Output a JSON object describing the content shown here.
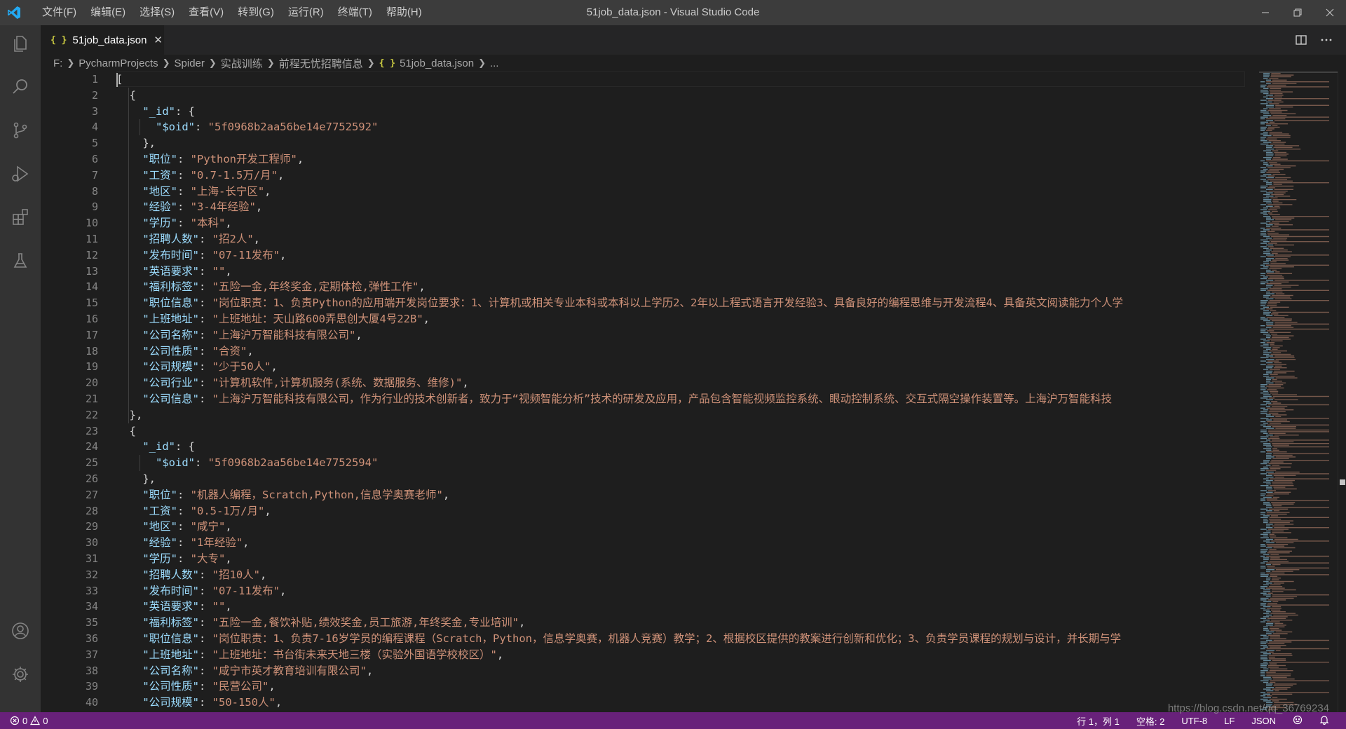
{
  "window": {
    "title": "51job_data.json - Visual Studio Code",
    "menu": [
      "文件(F)",
      "编辑(E)",
      "选择(S)",
      "查看(V)",
      "转到(G)",
      "运行(R)",
      "终端(T)",
      "帮助(H)"
    ]
  },
  "activity_bar": [
    "explorer-icon",
    "search-icon",
    "source-control-icon",
    "run-debug-icon",
    "extensions-icon",
    "testing-icon",
    "account-icon",
    "settings-gear-icon"
  ],
  "tab": {
    "icon": "{ }",
    "label": "51job_data.json",
    "close": "✕"
  },
  "breadcrumb": [
    "F:",
    "PycharmProjects",
    "Spider",
    "实战训练",
    "前程无忧招聘信息",
    "51job_data.json",
    "..."
  ],
  "editor": {
    "line_numbers": [
      "1",
      "2",
      "3",
      "4",
      "5",
      "6",
      "7",
      "8",
      "9",
      "10",
      "11",
      "12",
      "13",
      "14",
      "15",
      "16",
      "17",
      "18",
      "19",
      "20",
      "21",
      "22",
      "23",
      "24",
      "25",
      "26",
      "27",
      "28",
      "29",
      "30",
      "31",
      "32",
      "33",
      "34",
      "35",
      "36",
      "37",
      "38",
      "39",
      "40"
    ],
    "lines": [
      [
        [
          "p",
          "["
        ]
      ],
      [
        [
          "p",
          "  {"
        ]
      ],
      [
        [
          "k",
          "    \"_id\""
        ],
        [
          "p",
          ": {"
        ]
      ],
      [
        [
          "k",
          "      \"$oid\""
        ],
        [
          "p",
          ": "
        ],
        [
          "s",
          "\"5f0968b2aa56be14e7752592\""
        ]
      ],
      [
        [
          "p",
          "    },"
        ]
      ],
      [
        [
          "k",
          "    \"职位\""
        ],
        [
          "p",
          ": "
        ],
        [
          "s",
          "\"Python开发工程师\""
        ],
        [
          "p",
          ","
        ]
      ],
      [
        [
          "k",
          "    \"工资\""
        ],
        [
          "p",
          ": "
        ],
        [
          "s",
          "\"0.7-1.5万/月\""
        ],
        [
          "p",
          ","
        ]
      ],
      [
        [
          "k",
          "    \"地区\""
        ],
        [
          "p",
          ": "
        ],
        [
          "s",
          "\"上海-长宁区\""
        ],
        [
          "p",
          ","
        ]
      ],
      [
        [
          "k",
          "    \"经验\""
        ],
        [
          "p",
          ": "
        ],
        [
          "s",
          "\"3-4年经验\""
        ],
        [
          "p",
          ","
        ]
      ],
      [
        [
          "k",
          "    \"学历\""
        ],
        [
          "p",
          ": "
        ],
        [
          "s",
          "\"本科\""
        ],
        [
          "p",
          ","
        ]
      ],
      [
        [
          "k",
          "    \"招聘人数\""
        ],
        [
          "p",
          ": "
        ],
        [
          "s",
          "\"招2人\""
        ],
        [
          "p",
          ","
        ]
      ],
      [
        [
          "k",
          "    \"发布时间\""
        ],
        [
          "p",
          ": "
        ],
        [
          "s",
          "\"07-11发布\""
        ],
        [
          "p",
          ","
        ]
      ],
      [
        [
          "k",
          "    \"英语要求\""
        ],
        [
          "p",
          ": "
        ],
        [
          "s",
          "\"\""
        ],
        [
          "p",
          ","
        ]
      ],
      [
        [
          "k",
          "    \"福利标签\""
        ],
        [
          "p",
          ": "
        ],
        [
          "s",
          "\"五险一金,年终奖金,定期体检,弹性工作\""
        ],
        [
          "p",
          ","
        ]
      ],
      [
        [
          "k",
          "    \"职位信息\""
        ],
        [
          "p",
          ": "
        ],
        [
          "s",
          "\"岗位职责：1、负责Python的应用端开发岗位要求：1、计算机或相关专业本科或本科以上学历2、2年以上程式语言开发经验3、具备良好的编程思维与开发流程4、具备英文阅读能力个人学"
        ]
      ],
      [
        [
          "k",
          "    \"上班地址\""
        ],
        [
          "p",
          ": "
        ],
        [
          "s",
          "\"上班地址：天山路600弄思创大厦4号22B\""
        ],
        [
          "p",
          ","
        ]
      ],
      [
        [
          "k",
          "    \"公司名称\""
        ],
        [
          "p",
          ": "
        ],
        [
          "s",
          "\"上海沪万智能科技有限公司\""
        ],
        [
          "p",
          ","
        ]
      ],
      [
        [
          "k",
          "    \"公司性质\""
        ],
        [
          "p",
          ": "
        ],
        [
          "s",
          "\"合资\""
        ],
        [
          "p",
          ","
        ]
      ],
      [
        [
          "k",
          "    \"公司规模\""
        ],
        [
          "p",
          ": "
        ],
        [
          "s",
          "\"少于50人\""
        ],
        [
          "p",
          ","
        ]
      ],
      [
        [
          "k",
          "    \"公司行业\""
        ],
        [
          "p",
          ": "
        ],
        [
          "s",
          "\"计算机软件,计算机服务(系统、数据服务、维修)\""
        ],
        [
          "p",
          ","
        ]
      ],
      [
        [
          "k",
          "    \"公司信息\""
        ],
        [
          "p",
          ": "
        ],
        [
          "s",
          "\"上海沪万智能科技有限公司，作为行业的技术创新者，致力于“视频智能分析”技术的研发及应用，产品包含智能视频监控系统、眼动控制系统、交互式隔空操作装置等。上海沪万智能科技"
        ]
      ],
      [
        [
          "p",
          "  },"
        ]
      ],
      [
        [
          "p",
          "  {"
        ]
      ],
      [
        [
          "k",
          "    \"_id\""
        ],
        [
          "p",
          ": {"
        ]
      ],
      [
        [
          "k",
          "      \"$oid\""
        ],
        [
          "p",
          ": "
        ],
        [
          "s",
          "\"5f0968b2aa56be14e7752594\""
        ]
      ],
      [
        [
          "p",
          "    },"
        ]
      ],
      [
        [
          "k",
          "    \"职位\""
        ],
        [
          "p",
          ": "
        ],
        [
          "s",
          "\"机器人编程，Scratch,Python,信息学奥赛老师\""
        ],
        [
          "p",
          ","
        ]
      ],
      [
        [
          "k",
          "    \"工资\""
        ],
        [
          "p",
          ": "
        ],
        [
          "s",
          "\"0.5-1万/月\""
        ],
        [
          "p",
          ","
        ]
      ],
      [
        [
          "k",
          "    \"地区\""
        ],
        [
          "p",
          ": "
        ],
        [
          "s",
          "\"咸宁\""
        ],
        [
          "p",
          ","
        ]
      ],
      [
        [
          "k",
          "    \"经验\""
        ],
        [
          "p",
          ": "
        ],
        [
          "s",
          "\"1年经验\""
        ],
        [
          "p",
          ","
        ]
      ],
      [
        [
          "k",
          "    \"学历\""
        ],
        [
          "p",
          ": "
        ],
        [
          "s",
          "\"大专\""
        ],
        [
          "p",
          ","
        ]
      ],
      [
        [
          "k",
          "    \"招聘人数\""
        ],
        [
          "p",
          ": "
        ],
        [
          "s",
          "\"招10人\""
        ],
        [
          "p",
          ","
        ]
      ],
      [
        [
          "k",
          "    \"发布时间\""
        ],
        [
          "p",
          ": "
        ],
        [
          "s",
          "\"07-11发布\""
        ],
        [
          "p",
          ","
        ]
      ],
      [
        [
          "k",
          "    \"英语要求\""
        ],
        [
          "p",
          ": "
        ],
        [
          "s",
          "\"\""
        ],
        [
          "p",
          ","
        ]
      ],
      [
        [
          "k",
          "    \"福利标签\""
        ],
        [
          "p",
          ": "
        ],
        [
          "s",
          "\"五险一金,餐饮补贴,绩效奖金,员工旅游,年终奖金,专业培训\""
        ],
        [
          "p",
          ","
        ]
      ],
      [
        [
          "k",
          "    \"职位信息\""
        ],
        [
          "p",
          ": "
        ],
        [
          "s",
          "\"岗位职责：1、负责7-16岁学员的编程课程（Scratch，Python，信息学奥赛，机器人竞赛）教学；2、根据校区提供的教案进行创新和优化；3、负责学员课程的规划与设计，并长期与学"
        ]
      ],
      [
        [
          "k",
          "    \"上班地址\""
        ],
        [
          "p",
          ": "
        ],
        [
          "s",
          "\"上班地址：书台街未来天地三楼（实验外国语学校校区）\""
        ],
        [
          "p",
          ","
        ]
      ],
      [
        [
          "k",
          "    \"公司名称\""
        ],
        [
          "p",
          ": "
        ],
        [
          "s",
          "\"咸宁市英才教育培训有限公司\""
        ],
        [
          "p",
          ","
        ]
      ],
      [
        [
          "k",
          "    \"公司性质\""
        ],
        [
          "p",
          ": "
        ],
        [
          "s",
          "\"民营公司\""
        ],
        [
          "p",
          ","
        ]
      ],
      [
        [
          "k",
          "    \"公司规模\""
        ],
        [
          "p",
          ": "
        ],
        [
          "s",
          "\"50-150人\""
        ],
        [
          "p",
          ","
        ]
      ]
    ]
  },
  "statusbar": {
    "errors": "0",
    "warnings": "0",
    "position": "行 1，列 1",
    "indent": "空格: 2",
    "encoding": "UTF-8",
    "eol": "LF",
    "language": "JSON"
  },
  "watermark": "https://blog.csdn.net/qq_36769234",
  "colors": {
    "statusbar": "#68217a",
    "key": "#9cdcfe",
    "string": "#ce9178"
  }
}
